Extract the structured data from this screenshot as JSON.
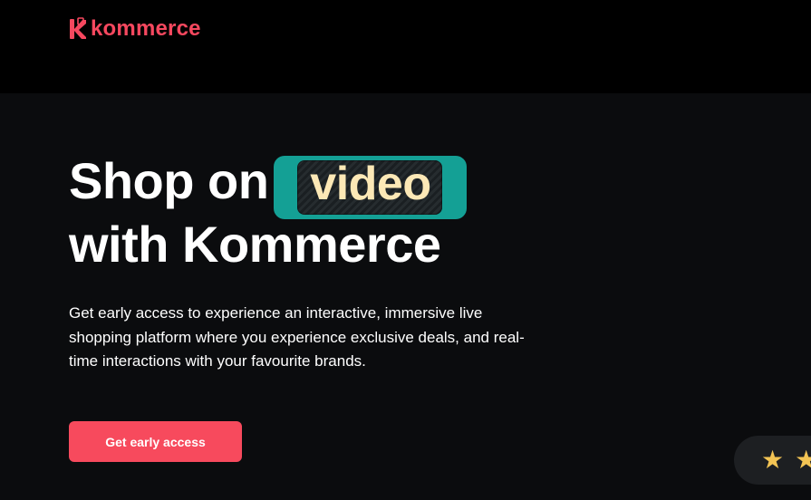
{
  "brand": {
    "name": "kommerce",
    "logo_icon": "kommerce-k-logo-icon",
    "color": "#f6485f"
  },
  "hero": {
    "title_line1": "Shop on",
    "highlight_word": "video",
    "title_line2": "with Kommerce",
    "description": "Get early access to experience an interactive, immersive live shopping platform where you experience exclusive deals, and real-time interactions with your favourite brands.",
    "highlight_bg_color": "#14a095",
    "highlight_text_color": "#fce8b6"
  },
  "cta": {
    "label": "Get early access",
    "color": "#f74a5d"
  },
  "rating": {
    "star_icon": "star-icon",
    "star_color": "#f3c454"
  },
  "colors": {
    "header_bg": "#000000",
    "page_bg": "#0b0c0e"
  }
}
